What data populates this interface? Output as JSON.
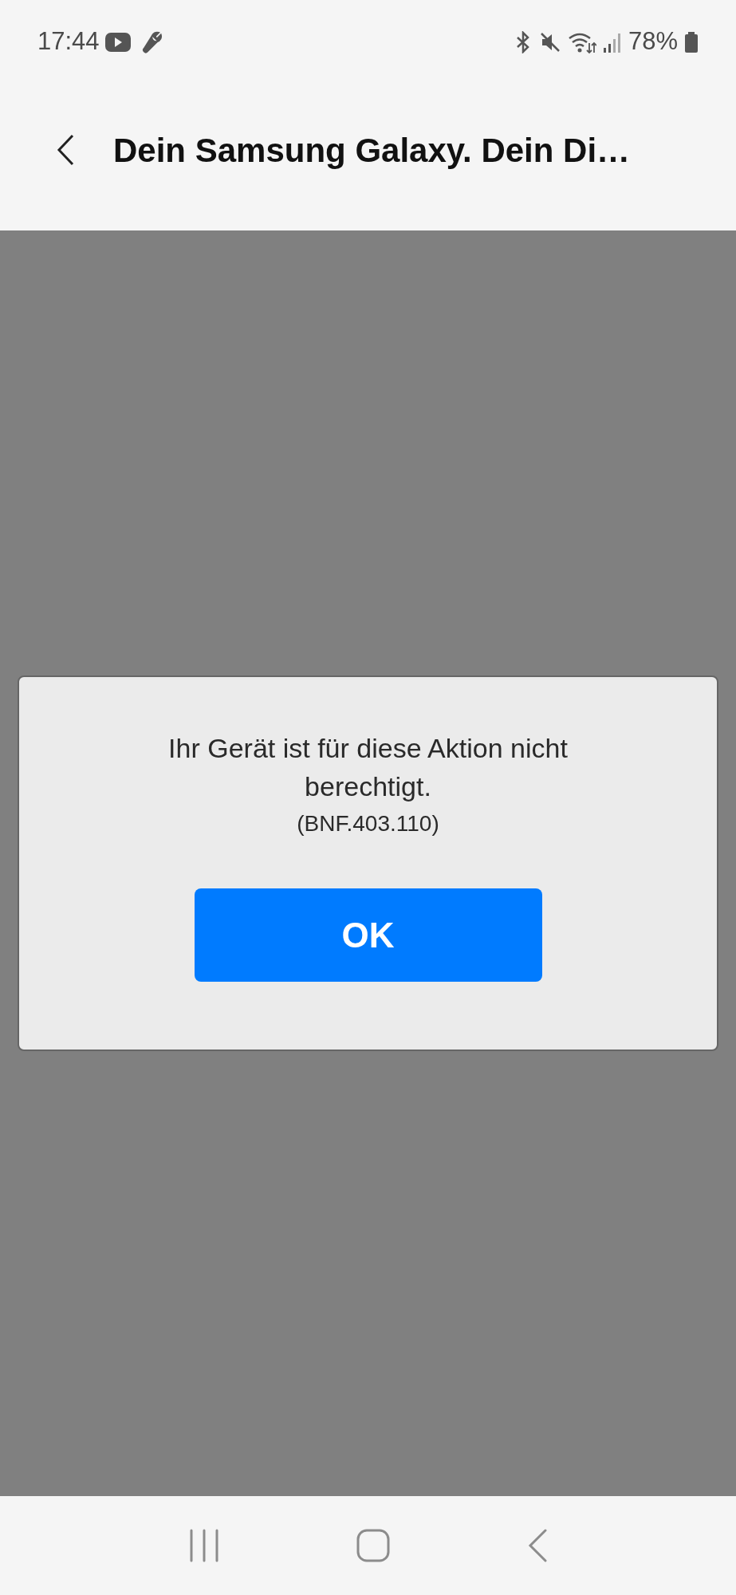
{
  "status_bar": {
    "time": "17:44",
    "battery": "78%"
  },
  "header": {
    "title": "Dein Samsung Galaxy. Dein Di…"
  },
  "dialog": {
    "message": "Ihr Gerät ist für diese Aktion nicht berechtigt.",
    "code": "(BNF.403.110)",
    "button": "OK"
  }
}
